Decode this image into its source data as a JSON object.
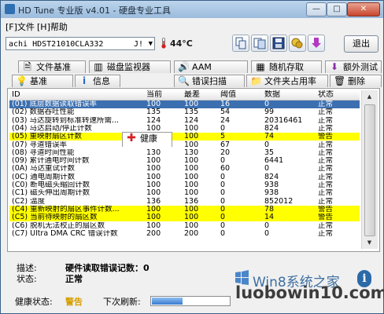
{
  "window": {
    "title": "HD Tune 专业版 v4.01 - 硬盘专业工具",
    "minimize_symbol": "—",
    "maximize_symbol": "□",
    "close_symbol": "✕"
  },
  "menu": {
    "file": "[F]文件",
    "help": "[H]帮助"
  },
  "toolbar": {
    "drive": "achi HDST21010CLA332",
    "drive_suffix": "J!",
    "temperature": "44°C",
    "exit_label": "退出",
    "icons": [
      "copy-icon",
      "copy-screen-icon",
      "save-icon",
      "options-icon",
      "download-icon"
    ]
  },
  "tabs": {
    "row1": [
      "文件基准",
      "磁盘监视器",
      "AAM",
      "随机存取",
      "额外测试"
    ],
    "row2": [
      "基准",
      "信息",
      "健康",
      "错误扫描",
      "文件夹占用率",
      "删除"
    ],
    "active": "健康"
  },
  "table": {
    "columns": [
      "ID",
      "当前",
      "最差",
      "阈值",
      "数据",
      "状态"
    ],
    "rows": [
      {
        "id": "(01) 底层数据读取错误率",
        "current": "100",
        "worst": "100",
        "threshold": "16",
        "data": "0",
        "status": "正常",
        "style": "sel"
      },
      {
        "id": "(02) 数据吞吐性能",
        "current": "135",
        "worst": "135",
        "threshold": "54",
        "data": "99",
        "status": "正常",
        "style": ""
      },
      {
        "id": "(03) 马达旋转到标准转速所需...",
        "current": "124",
        "worst": "124",
        "threshold": "24",
        "data": "20316461",
        "status": "正常",
        "style": ""
      },
      {
        "id": "(04) 马达启动/停止计数",
        "current": "100",
        "worst": "100",
        "threshold": "0",
        "data": "824",
        "status": "正常",
        "style": ""
      },
      {
        "id": "(05) 重映射扇区计数",
        "current": "100",
        "worst": "100",
        "threshold": "5",
        "data": "74",
        "status": "警告",
        "style": "warn"
      },
      {
        "id": "(07) 寻道错误率",
        "current": "100",
        "worst": "100",
        "threshold": "67",
        "data": "0",
        "status": "正常",
        "style": ""
      },
      {
        "id": "(08) 寻道时间性能",
        "current": "130",
        "worst": "130",
        "threshold": "20",
        "data": "35",
        "status": "正常",
        "style": ""
      },
      {
        "id": "(09) 累计通电时间计数",
        "current": "100",
        "worst": "100",
        "threshold": "0",
        "data": "6441",
        "status": "正常",
        "style": ""
      },
      {
        "id": "(0A) 马达重试计数",
        "current": "100",
        "worst": "100",
        "threshold": "60",
        "data": "0",
        "status": "正常",
        "style": ""
      },
      {
        "id": "(0C) 通电周期计数",
        "current": "100",
        "worst": "100",
        "threshold": "0",
        "data": "824",
        "status": "正常",
        "style": ""
      },
      {
        "id": "(C0) 断电磁头缩回计数",
        "current": "100",
        "worst": "100",
        "threshold": "0",
        "data": "938",
        "status": "正常",
        "style": ""
      },
      {
        "id": "(C1) 磁头伸出周期计数",
        "current": "100",
        "worst": "100",
        "threshold": "0",
        "data": "938",
        "status": "正常",
        "style": ""
      },
      {
        "id": "(C2) 温度",
        "current": "136",
        "worst": "136",
        "threshold": "0",
        "data": "852012",
        "status": "正常",
        "style": ""
      },
      {
        "id": "(C4) 重新映射的扇区事件计数...",
        "current": "100",
        "worst": "100",
        "threshold": "0",
        "data": "78",
        "status": "警告",
        "style": "warn"
      },
      {
        "id": "(C5) 当前待映射的扇区数",
        "current": "100",
        "worst": "100",
        "threshold": "0",
        "data": "14",
        "status": "警告",
        "style": "warn"
      },
      {
        "id": "(C6) 脱机无法校正的扇区数",
        "current": "100",
        "worst": "100",
        "threshold": "0",
        "data": "0",
        "status": "正常",
        "style": ""
      },
      {
        "id": "(C7) Ultra DMA CRC 错误计数",
        "current": "200",
        "worst": "200",
        "threshold": "0",
        "data": "0",
        "status": "正常",
        "style": ""
      }
    ]
  },
  "description": {
    "desc_label": "描述:",
    "desc_value": "硬件读取错误记数：0",
    "status_label": "状态:",
    "status_value": "正常"
  },
  "status_bar": {
    "health_label": "健康状态:",
    "health_value": "警告",
    "refresh_label": "下次刷新:",
    "refresh_progress": 0.4
  },
  "watermark": {
    "text": "Win8系统之家",
    "url": "luobowin10.com",
    "info_glyph": "i"
  }
}
